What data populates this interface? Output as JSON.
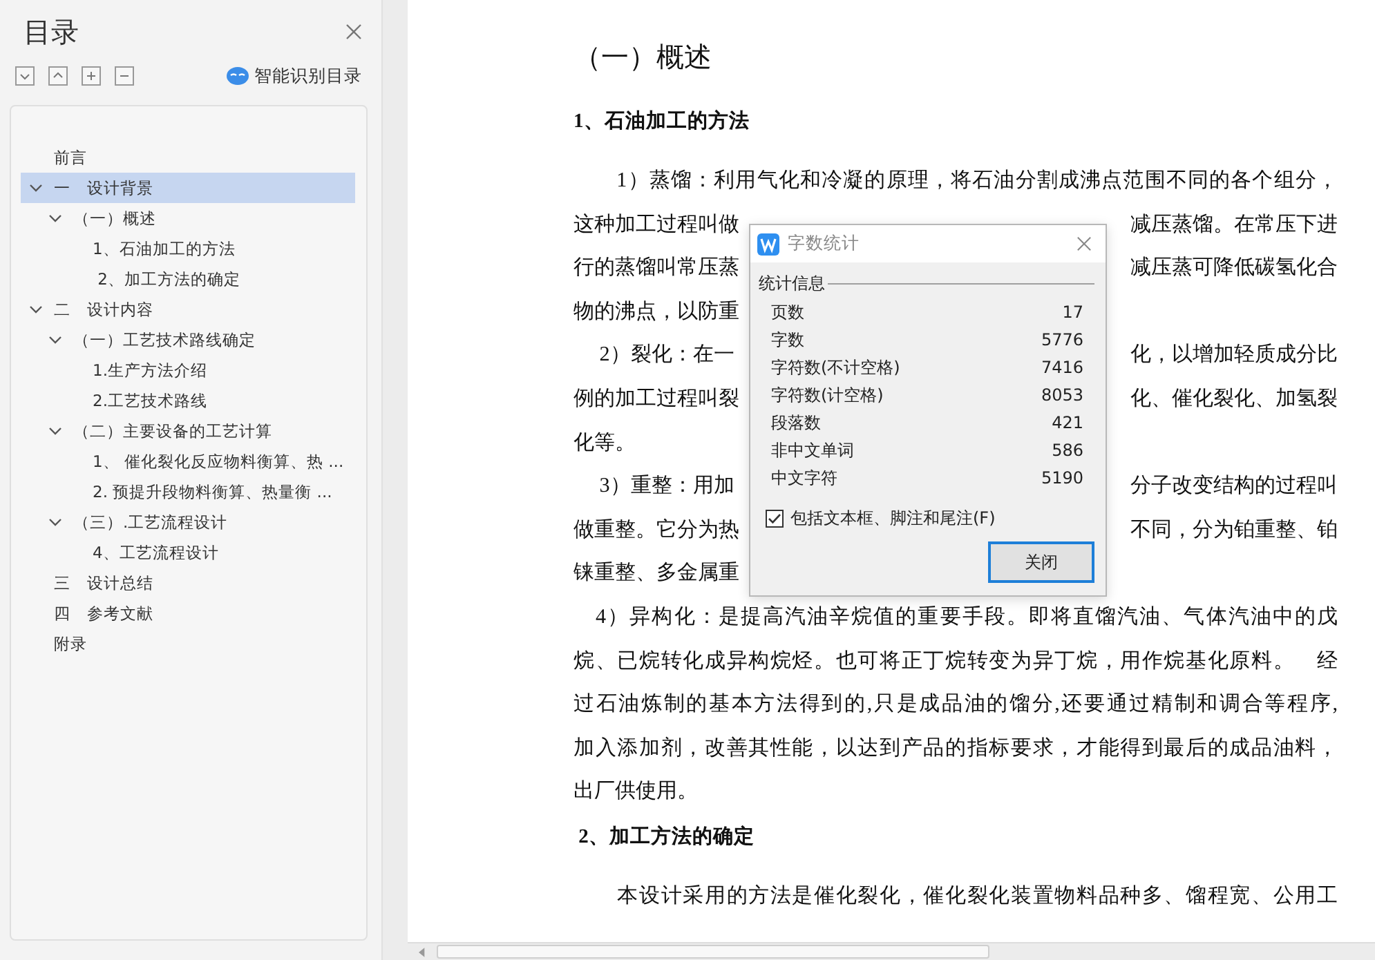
{
  "toc_panel": {
    "title": "目录",
    "smart_toc_label": "智能识别目录",
    "items": [
      {
        "label": "前言",
        "selected": false
      },
      {
        "label": "一　设计背景",
        "expanded": true,
        "selected": true,
        "children": [
          {
            "label": "（一）概述",
            "expanded": true,
            "selected": false,
            "children": [
              {
                "label": "1、石油加工的方法",
                "selected": false
              },
              {
                "label": " 2、加工方法的确定",
                "selected": false
              }
            ]
          }
        ]
      },
      {
        "label": "二　设计内容",
        "expanded": true,
        "selected": false,
        "children": [
          {
            "label": "（一）工艺技术路线确定",
            "expanded": true,
            "selected": false,
            "children": [
              {
                "label": "1.生产方法介绍",
                "selected": false
              },
              {
                "label": "2.工艺技术路线",
                "selected": false
              }
            ]
          },
          {
            "label": "（二）主要设备的工艺计算",
            "expanded": true,
            "selected": false,
            "children": [
              {
                "label": "1、 催化裂化反应物料衡算、热 ...",
                "selected": false
              },
              {
                "label": "2. 预提升段物料衡算、热量衡 ...",
                "selected": false
              }
            ]
          },
          {
            "label": "（三）.工艺流程设计",
            "expanded": true,
            "selected": false,
            "children": [
              {
                "label": "4、工艺流程设计",
                "selected": false
              }
            ]
          }
        ]
      },
      {
        "label": "三　设计总结",
        "selected": false
      },
      {
        "label": "四　参考文献",
        "selected": false
      },
      {
        "label": "附录",
        "selected": false
      }
    ]
  },
  "document": {
    "lines": [
      {
        "kind": "title",
        "text": "（一）概述"
      },
      {
        "kind": "subtitle",
        "text": "1、石油加工的方法"
      },
      {
        "kind": "full",
        "text": "　　1）蒸馏：利用气化和冷凝的原理，将石油分割成沸点范围不同的各个组分，"
      },
      {
        "kind": "split",
        "left": "这种加工过程叫做",
        "right": "减压蒸馏。在常压下进"
      },
      {
        "kind": "split",
        "left": "行的蒸馏叫常压蒸",
        "right": "减压蒸可降低碳氢化合"
      },
      {
        "kind": "split",
        "left": "物的沸点，以防重"
      },
      {
        "kind": "split",
        "left": "　 2）裂化：在一",
        "right": "化，以增加轻质成分比"
      },
      {
        "kind": "split",
        "left": "例的加工过程叫裂",
        "right": "化、催化裂化、加氢裂"
      },
      {
        "kind": "end",
        "text": "化等。"
      },
      {
        "kind": "split",
        "left": "　 3）重整：用加",
        "right": "分子改变结构的过程叫"
      },
      {
        "kind": "split",
        "left": "做重整。它分为热",
        "right": "不同，分为铂重整、铂"
      },
      {
        "kind": "split",
        "left": "铼重整、多金属重"
      },
      {
        "kind": "full",
        "text": "　4）异构化：是提高汽油辛烷值的重要手段。即将直馏汽油、气体汽油中的戊"
      },
      {
        "kind": "full",
        "text": "烷、已烷转化成异构烷烃。也可将正丁烷转变为异丁烷，用作烷基化原料。　经"
      },
      {
        "kind": "full",
        "text": "过石油炼制的基本方法得到的,只是成品油的馏分,还要通过精制和调合等程序,"
      },
      {
        "kind": "full",
        "text": "加入添加剂，改善其性能，以达到产品的指标要求，才能得到最后的成品油料，"
      },
      {
        "kind": "end",
        "text": "出厂供使用。"
      },
      {
        "kind": "subtitle",
        "text": " 2、加工方法的确定"
      },
      {
        "kind": "full",
        "text": "　　本设计采用的方法是催化裂化，催化裂化装置物料品种多、馏程宽、公用工"
      }
    ]
  },
  "dialog": {
    "title": "字数统计",
    "group_label": "统计信息",
    "stats": [
      {
        "label": "页数",
        "value": "17"
      },
      {
        "label": "字数",
        "value": "5776"
      },
      {
        "label": "字符数(不计空格)",
        "value": "7416"
      },
      {
        "label": "字符数(计空格)",
        "value": "8053"
      },
      {
        "label": "段落数",
        "value": "421"
      },
      {
        "label": "非中文单词",
        "value": "586"
      },
      {
        "label": "中文字符",
        "value": "5190"
      }
    ],
    "checkbox": {
      "label": "包括文本框、脚注和尾注(F)",
      "checked": true
    },
    "close_button": "关闭"
  }
}
